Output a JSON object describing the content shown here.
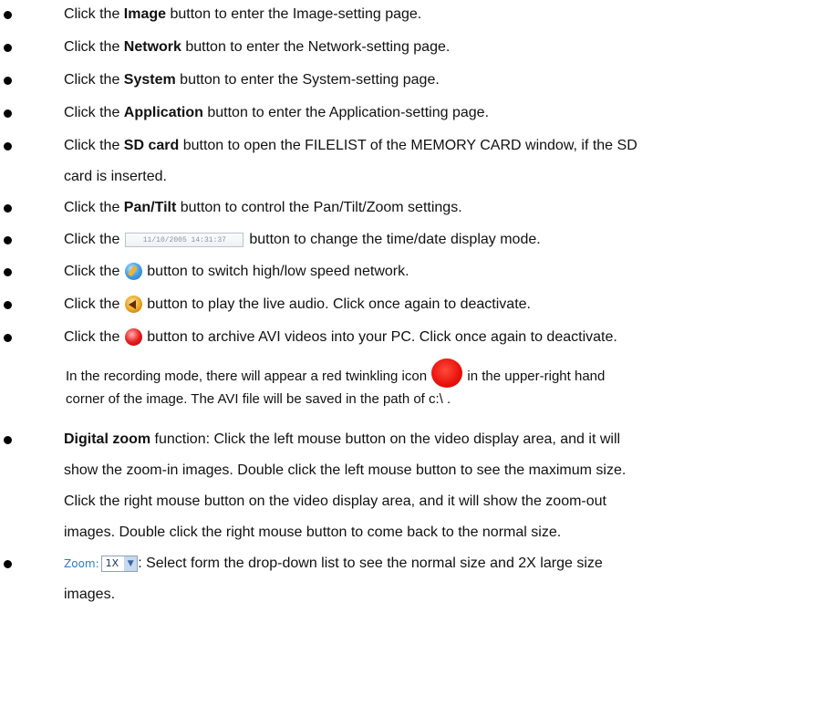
{
  "items": [
    {
      "pre": "Click the ",
      "bold": "Image",
      "post": " button to enter the Image-setting page."
    },
    {
      "pre": "Click the ",
      "bold": "Network",
      "post": " button to enter the Network-setting page."
    },
    {
      "pre": "Click the ",
      "bold": "System",
      "post": " button to enter the System-setting page."
    },
    {
      "pre": "Click the ",
      "bold": "Application",
      "post": " button to enter the Application-setting page."
    },
    {
      "pre": "Click the ",
      "bold": "SD card",
      "post": " button to open the FILELIST of the MEMORY CARD window, if the SD",
      "cont": "card is inserted."
    },
    {
      "pre": "Click the ",
      "bold": "Pan/Tilt",
      "post": " button to control the Pan/Tilt/Zoom settings."
    },
    {
      "pre": "Click the",
      "datetime": "11/10/2005 14:31:37",
      "post": "button to change the time/date display mode."
    },
    {
      "pre": "Click the",
      "icon": "network-speed-icon",
      "post": "button to switch high/low speed network."
    },
    {
      "pre": "Click the",
      "icon": "audio-speaker-icon",
      "post": "button to play the live audio. Click once again to deactivate."
    },
    {
      "pre": "Click the",
      "icon": "record-icon",
      "post": "button to archive AVI videos into your PC. Click once again to deactivate.",
      "cont_a": "In the recording mode, there will appear a red twinkling icon",
      "cont_b": "in the upper-right hand",
      "cont2": "corner of the image. The AVI file will be saved in the path of c:\\ ."
    },
    {
      "bold": "Digital zoom",
      "post": " function: Click the left mouse button on the video display area, and it will",
      "cont": [
        "show the zoom-in images. Double click the left mouse button to see the maximum size.",
        "Click the right mouse button on the video display area, and it will show the zoom-out",
        "images. Double click the right mouse button to come back to the normal size."
      ]
    },
    {
      "zoom_label": "Zoom:",
      "zoom_value": "1X",
      "post": ": Select form the drop-down list to see the normal size and 2X large size",
      "cont": "images."
    }
  ]
}
